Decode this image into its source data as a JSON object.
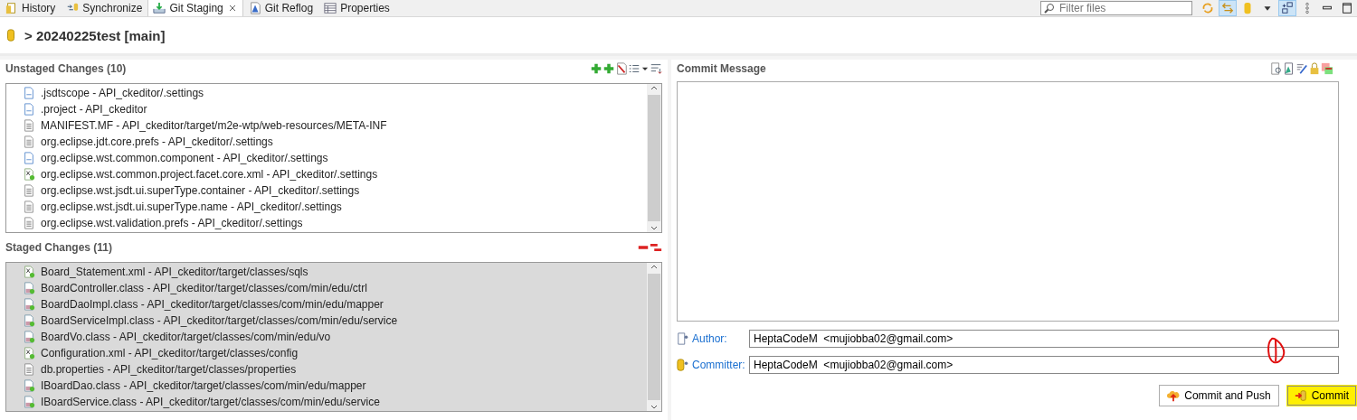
{
  "tabs": [
    {
      "label": "History",
      "kind": "history",
      "selected": false,
      "closable": false
    },
    {
      "label": "Synchronize",
      "kind": "sync",
      "selected": false,
      "closable": false
    },
    {
      "label": "Git Staging",
      "kind": "staging",
      "selected": true,
      "closable": true
    },
    {
      "label": "Git Reflog",
      "kind": "reflog",
      "selected": false,
      "closable": false
    },
    {
      "label": "Properties",
      "kind": "properties",
      "selected": false,
      "closable": false
    }
  ],
  "filter": {
    "placeholder": "Filter files"
  },
  "repository": {
    "title": "> 20240225test [main]"
  },
  "unstaged": {
    "title": "Unstaged Changes (10)",
    "files": [
      {
        "name": ".jsdtscope - API_ckeditor/.settings",
        "kind": "unknown"
      },
      {
        "name": ".project - API_ckeditor",
        "kind": "unknown"
      },
      {
        "name": "MANIFEST.MF - API_ckeditor/target/m2e-wtp/web-resources/META-INF",
        "kind": "text"
      },
      {
        "name": "org.eclipse.jdt.core.prefs - API_ckeditor/.settings",
        "kind": "text"
      },
      {
        "name": "org.eclipse.wst.common.component - API_ckeditor/.settings",
        "kind": "unknown"
      },
      {
        "name": "org.eclipse.wst.common.project.facet.core.xml - API_ckeditor/.settings",
        "kind": "xml"
      },
      {
        "name": "org.eclipse.wst.jsdt.ui.superType.container - API_ckeditor/.settings",
        "kind": "text"
      },
      {
        "name": "org.eclipse.wst.jsdt.ui.superType.name - API_ckeditor/.settings",
        "kind": "text"
      },
      {
        "name": "org.eclipse.wst.validation.prefs - API_ckeditor/.settings",
        "kind": "text"
      }
    ]
  },
  "staged": {
    "title": "Staged Changes (11)",
    "files": [
      {
        "name": "Board_Statement.xml - API_ckeditor/target/classes/sqls",
        "kind": "xml"
      },
      {
        "name": "BoardController.class - API_ckeditor/target/classes/com/min/edu/ctrl",
        "kind": "class"
      },
      {
        "name": "BoardDaoImpl.class - API_ckeditor/target/classes/com/min/edu/mapper",
        "kind": "class"
      },
      {
        "name": "BoardServiceImpl.class - API_ckeditor/target/classes/com/min/edu/service",
        "kind": "class"
      },
      {
        "name": "BoardVo.class - API_ckeditor/target/classes/com/min/edu/vo",
        "kind": "class"
      },
      {
        "name": "Configuration.xml - API_ckeditor/target/classes/config",
        "kind": "xml"
      },
      {
        "name": "db.properties - API_ckeditor/target/classes/properties",
        "kind": "text"
      },
      {
        "name": "IBoardDao.class - API_ckeditor/target/classes/com/min/edu/mapper",
        "kind": "class"
      },
      {
        "name": "IBoardService.class - API_ckeditor/target/classes/com/min/edu/service",
        "kind": "class"
      }
    ]
  },
  "commit": {
    "title": "Commit Message",
    "author_label": "Author:",
    "author": "HeptaCodeM  <mujiobba02@gmail.com>",
    "committer_label": "Committer:",
    "committer": "HeptaCodeM  <mujiobba02@gmail.com>"
  },
  "buttons": [
    {
      "label": "Commit and Push",
      "kind": "push",
      "highlighted": false
    },
    {
      "label": "Commit",
      "kind": "commit",
      "highlighted": true
    }
  ]
}
